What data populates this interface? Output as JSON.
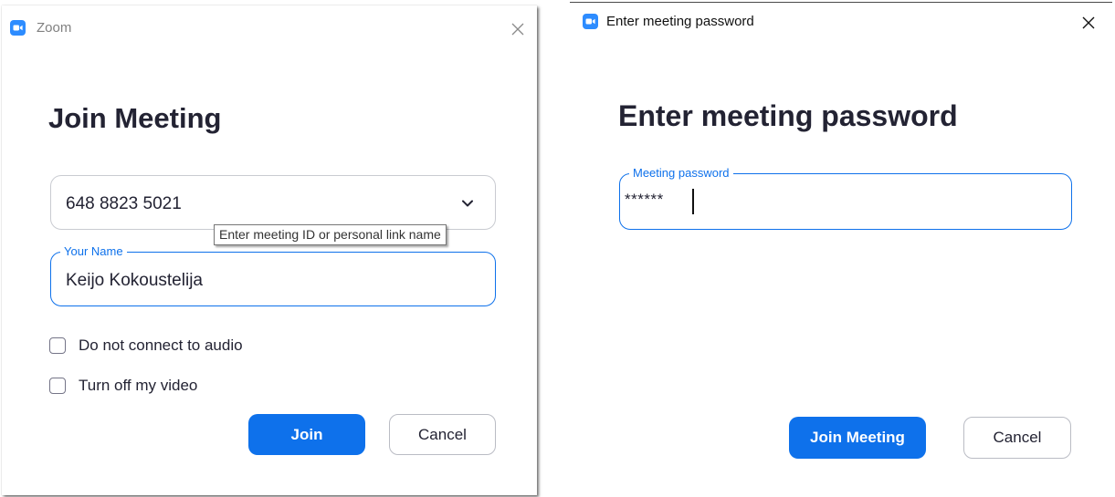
{
  "join_dialog": {
    "window_title": "Zoom",
    "heading": "Join Meeting",
    "meeting_id": {
      "value": "648 8823 5021",
      "tooltip": "Enter meeting ID or personal link name"
    },
    "name_field": {
      "label": "Your Name",
      "value": "Keijo Kokoustelija"
    },
    "options": [
      {
        "label": "Do not connect to audio",
        "checked": false
      },
      {
        "label": "Turn off my video",
        "checked": false
      }
    ],
    "join_button": "Join",
    "cancel_button": "Cancel"
  },
  "password_dialog": {
    "window_title": "Enter meeting password",
    "heading": "Enter meeting password",
    "password_field": {
      "label": "Meeting password",
      "value": "******"
    },
    "join_button": "Join Meeting",
    "cancel_button": "Cancel"
  },
  "colors": {
    "accent": "#0e71eb",
    "app_icon": "#2d8cff",
    "heading_text": "#232333"
  },
  "icons": [
    "zoom-app-icon",
    "close-icon",
    "chevron-down-icon"
  ]
}
